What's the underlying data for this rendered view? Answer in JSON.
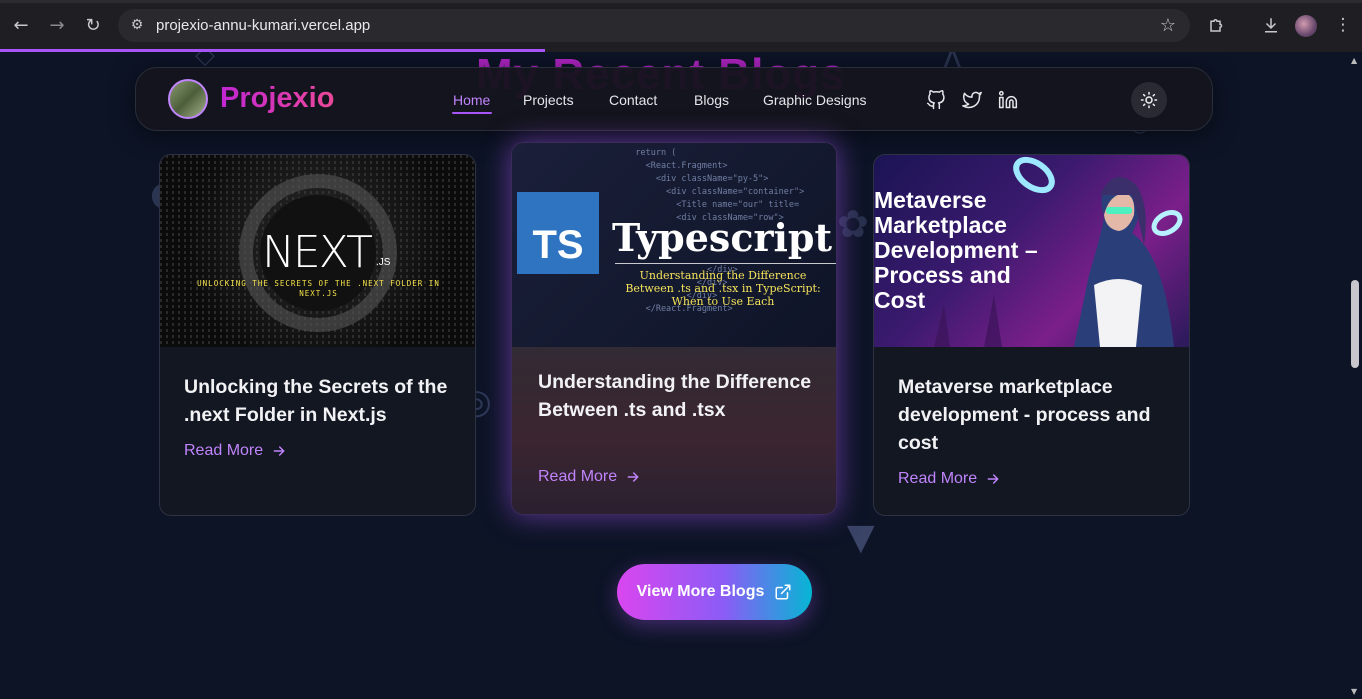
{
  "browser": {
    "url": "projexio-annu-kumari.vercel.app",
    "icons": {
      "back": "back-arrow-icon",
      "forward": "forward-arrow-icon",
      "reload": "reload-icon",
      "site_info": "site-info-icon",
      "bookmark": "star-icon",
      "extensions": "puzzle-icon",
      "download": "download-icon",
      "menu": "kebab-menu-icon"
    },
    "page_load_progress": 0.4
  },
  "background": {
    "section_title": "My Recent Blogs"
  },
  "navbar": {
    "brand": "Projexio",
    "links": [
      {
        "label": "Home",
        "active": true
      },
      {
        "label": "Projects"
      },
      {
        "label": "Contact"
      },
      {
        "label": "Blogs"
      },
      {
        "label": "Graphic Designs"
      }
    ],
    "socials": [
      "github-icon",
      "twitter-icon",
      "linkedin-icon"
    ],
    "theme_toggle": "sun-icon"
  },
  "blogs": [
    {
      "title": "Unlocking the Secrets of the .next Folder in Next.js",
      "read_more": "Read More",
      "image": {
        "logo_text": "NEXT",
        "logo_sub": ".JS",
        "caption_line1": "UNLOCKING THE SECRETS OF THE .NEXT FOLDER IN",
        "caption_line2": "NEXT.JS"
      }
    },
    {
      "title": "Understanding the Difference Between .ts and .tsx",
      "read_more": "Read More",
      "image": {
        "badge": "TS",
        "heading": "Typescript",
        "caption_line1": "Understanding the Difference",
        "caption_line2": "Between .ts and .tsx in TypeScript:",
        "caption_line3": "When to Use Each"
      }
    },
    {
      "title": "Metaverse marketplace development - process and cost",
      "read_more": "Read More",
      "image": {
        "line1": "Metaverse",
        "line2": "Marketplace",
        "line3": "Development –",
        "line4": "Process and",
        "line5": "Cost"
      }
    }
  ],
  "cta": {
    "label": "View More Blogs",
    "icon": "external-link-icon"
  },
  "colors": {
    "accent": "#a855f7",
    "brand_gradient_start": "#c026d3",
    "brand_gradient_end": "#ec4899",
    "cta_end": "#06b6d4"
  }
}
